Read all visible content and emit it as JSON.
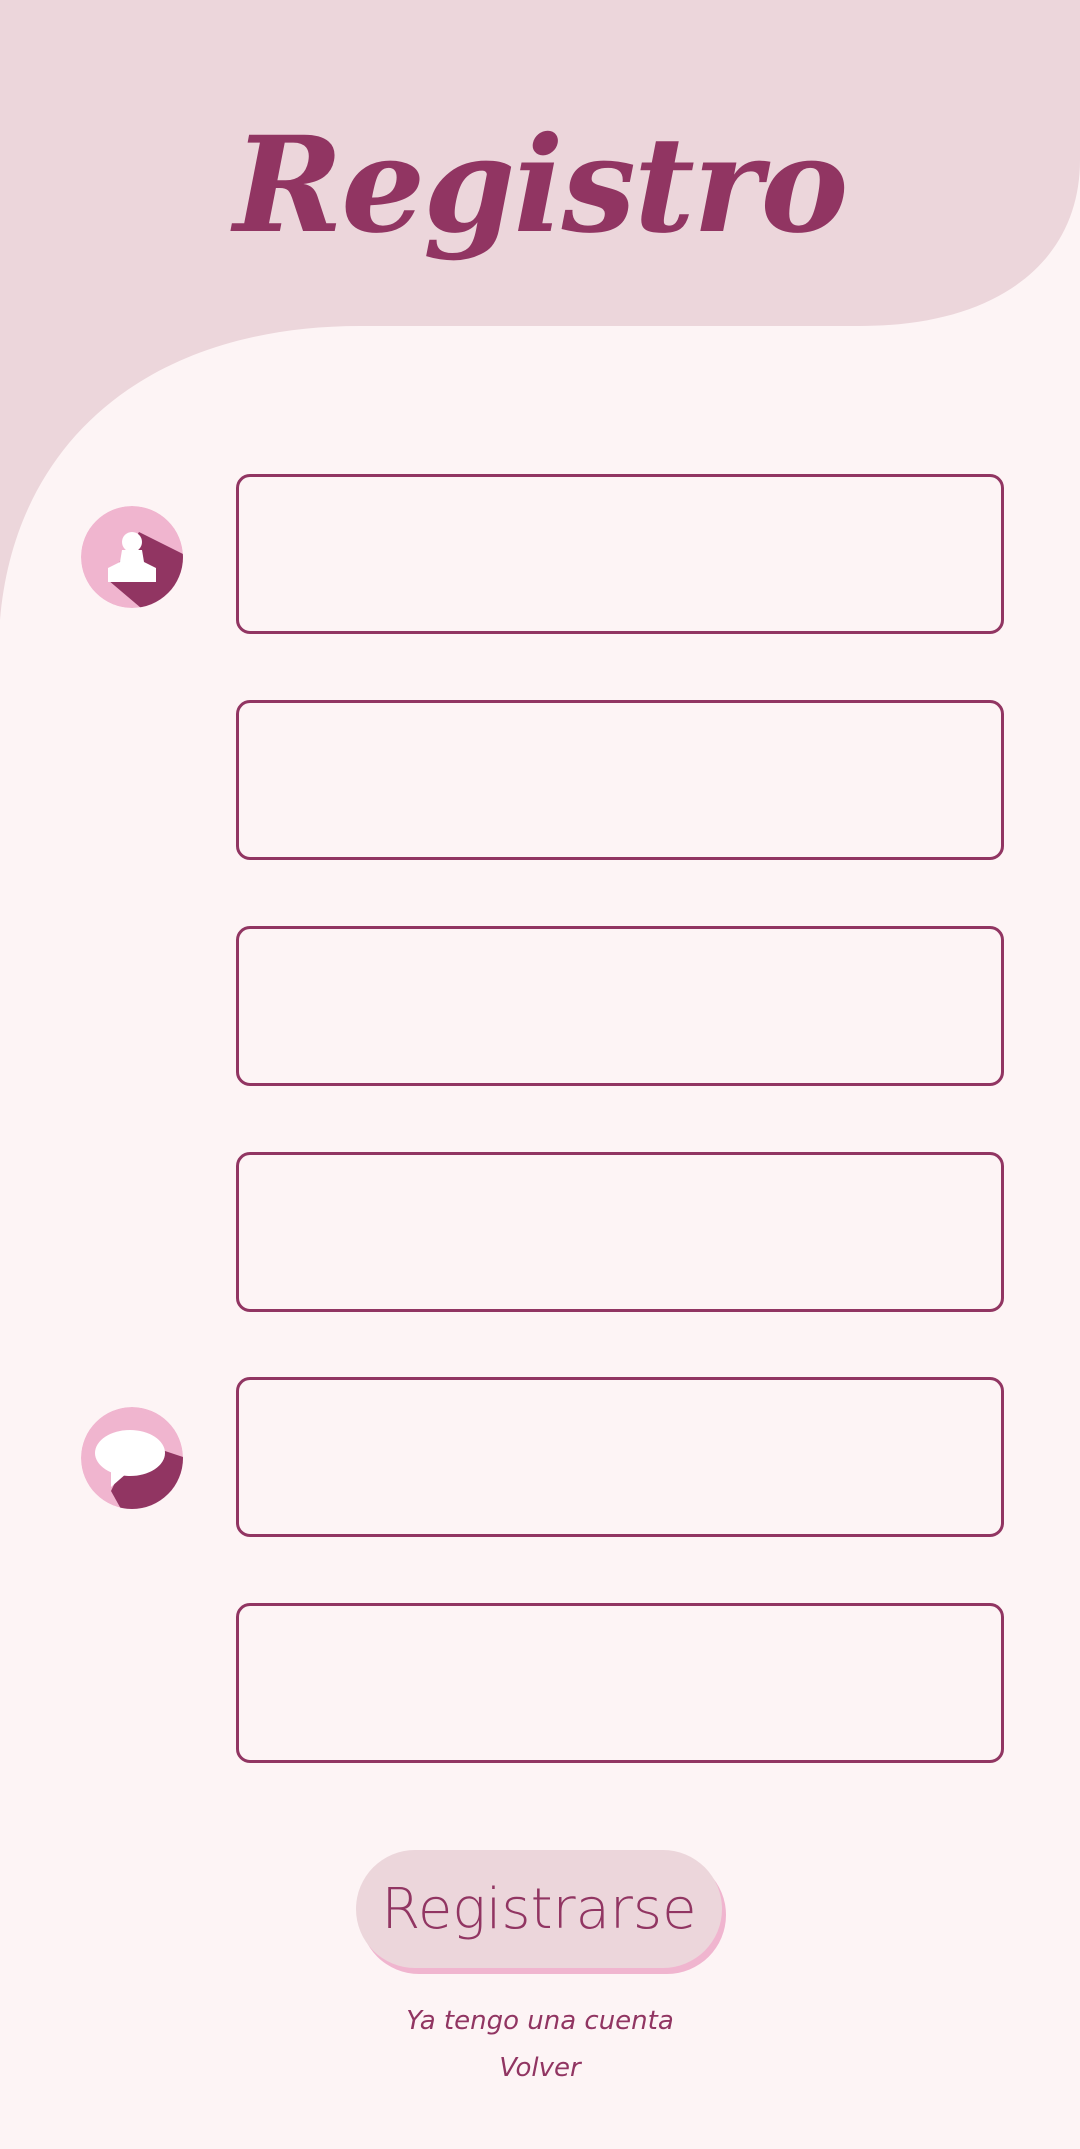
{
  "header": {
    "title": "Registro"
  },
  "form": {
    "fields": [
      {
        "icon": "user-icon",
        "value": "",
        "placeholder": ""
      },
      {
        "icon": "",
        "value": "",
        "placeholder": ""
      },
      {
        "icon": "",
        "value": "",
        "placeholder": ""
      },
      {
        "icon": "",
        "value": "",
        "placeholder": ""
      },
      {
        "icon": "speech-bubble-icon",
        "value": "",
        "placeholder": ""
      },
      {
        "icon": "",
        "value": "",
        "placeholder": ""
      }
    ],
    "submit_label": "Registrarse"
  },
  "footer": {
    "have_account_label": "Ya tengo una cuenta",
    "back_label": "Volver"
  },
  "colors": {
    "background": "#FDF4F5",
    "header_shape": "#ECD6DB",
    "accent": "#913562",
    "icon_circle": "#F0B5CF",
    "button_bg": "#ECD6DB",
    "button_shadow": "#F0B5CF"
  }
}
